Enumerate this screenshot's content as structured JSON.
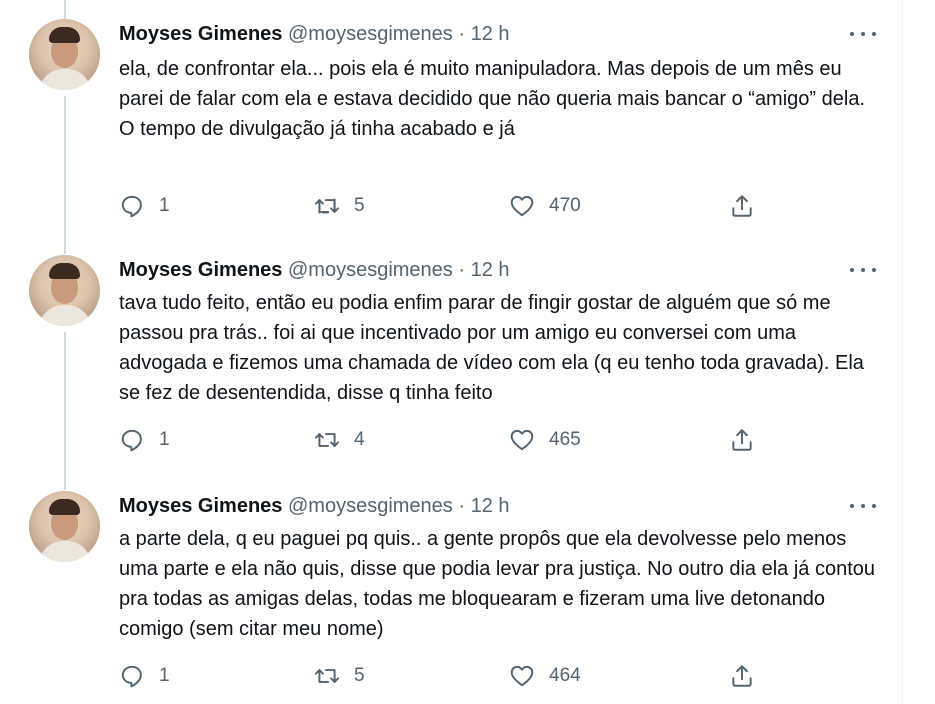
{
  "tweets": [
    {
      "name": "Moyses Gimenes",
      "handle": "@moysesgimenes",
      "sep": "·",
      "time": "12 h",
      "lines": [
        "ela, de confrontar ela... pois ela é muito manipuladora. Mas depois de um mês eu parei de falar com ela e estava decidido que não queria mais bancar o “amigo” dela.",
        "O tempo de divulgação já tinha acabado e já"
      ],
      "replies": "1",
      "retweets": "5",
      "likes": "470"
    },
    {
      "name": "Moyses Gimenes",
      "handle": "@moysesgimenes",
      "sep": "·",
      "time": "12 h",
      "lines": [
        "tava tudo feito, então eu podia enfim parar de fingir gostar de alguém que só me passou pra trás.. foi ai que incentivado por um amigo eu conversei com uma advogada e fizemos uma chamada de vídeo com ela (q eu tenho toda gravada). Ela se fez de desentendida, disse q tinha feito"
      ],
      "replies": "1",
      "retweets": "4",
      "likes": "465"
    },
    {
      "name": "Moyses Gimenes",
      "handle": "@moysesgimenes",
      "sep": "·",
      "time": "12 h",
      "lines": [
        "a parte dela, q eu paguei pq quis.. a gente propôs que ela devolvesse pelo menos uma parte e ela não quis, disse que podia levar pra justiça. No outro dia ela já contou pra todas as amigas delas, todas me bloquearam e fizeram uma live detonando comigo (sem citar meu nome)"
      ],
      "replies": "1",
      "retweets": "5",
      "likes": "464"
    }
  ],
  "icons": {
    "reply": "reply-icon",
    "retweet": "retweet-icon",
    "like": "heart-icon",
    "share": "share-icon",
    "more": "more-icon"
  },
  "colors": {
    "text": "#0f1419",
    "secondary": "#536471",
    "thread_line": "#cfd9de"
  }
}
